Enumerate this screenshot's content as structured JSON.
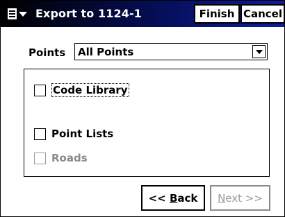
{
  "window": {
    "title": "Export to 1124-1",
    "finish_label": "Finish",
    "cancel_label": "Cancel"
  },
  "points": {
    "label": "Points",
    "selected": "All Points"
  },
  "options": {
    "code_library": {
      "label": "Code Library",
      "checked": false,
      "enabled": true
    },
    "point_lists": {
      "label": "Point Lists",
      "checked": false,
      "enabled": true
    },
    "roads": {
      "label": "Roads",
      "checked": false,
      "enabled": false
    }
  },
  "nav": {
    "back_prefix": "<< ",
    "back_hotkey": "B",
    "back_rest": "ack",
    "next_hotkey": "N",
    "next_rest": "ext >>"
  },
  "colors": {
    "titlebar_start": "#000000",
    "titlebar_end": "#0d1d9e",
    "disabled_text": "#8a8a8a"
  },
  "icons": {
    "start": "windows-start-icon",
    "dropdown": "chevron-down-icon"
  }
}
